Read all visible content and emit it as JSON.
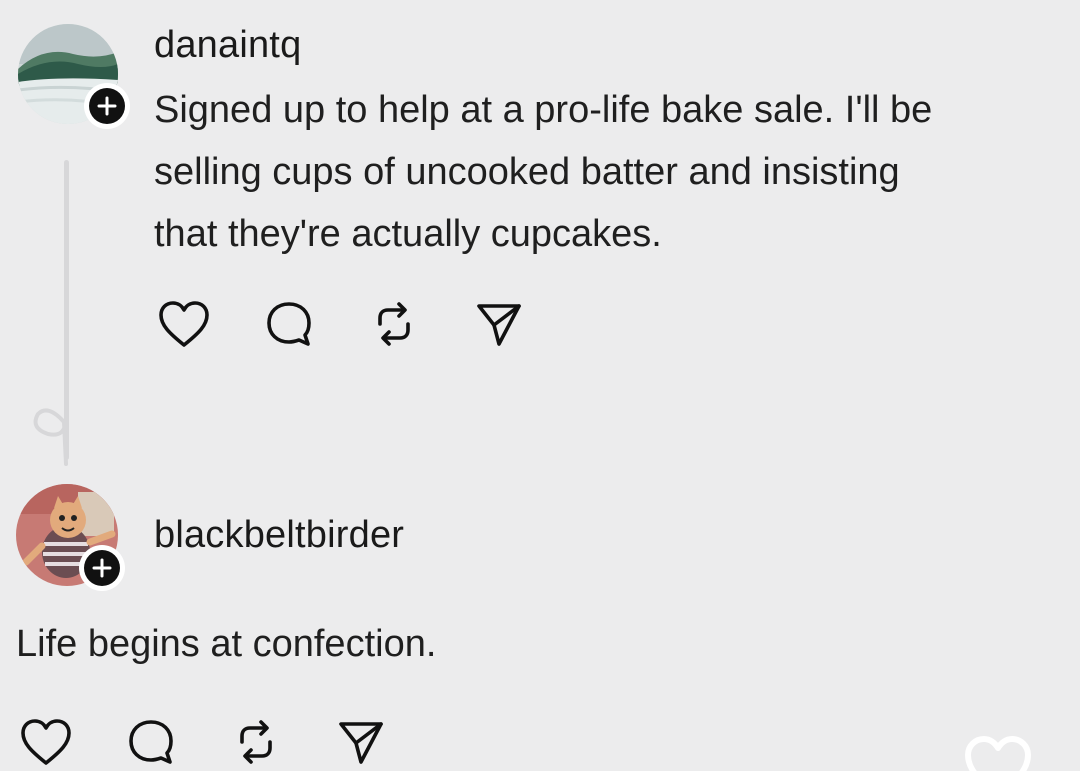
{
  "posts": [
    {
      "username": "danaintq",
      "text_lines": [
        "Signed up to help at a pro-life bake sale. I'll be",
        "selling cups of uncooked batter and insisting",
        "that they're actually cupcakes."
      ],
      "avatar_icon": "wave-photo-avatar",
      "follow_badge_icon": "plus-icon"
    },
    {
      "username": "blackbeltbirder",
      "text_lines": [
        "Life begins at confection."
      ],
      "avatar_icon": "cartoon-cat-avatar",
      "follow_badge_icon": "plus-icon"
    }
  ],
  "action_icons": [
    "heart-icon",
    "comment-icon",
    "repost-icon",
    "share-icon"
  ],
  "colors": {
    "background": "#ececed",
    "text": "#1a1a1a",
    "badge": "#111111",
    "thread_line": "#d7d7d9"
  }
}
